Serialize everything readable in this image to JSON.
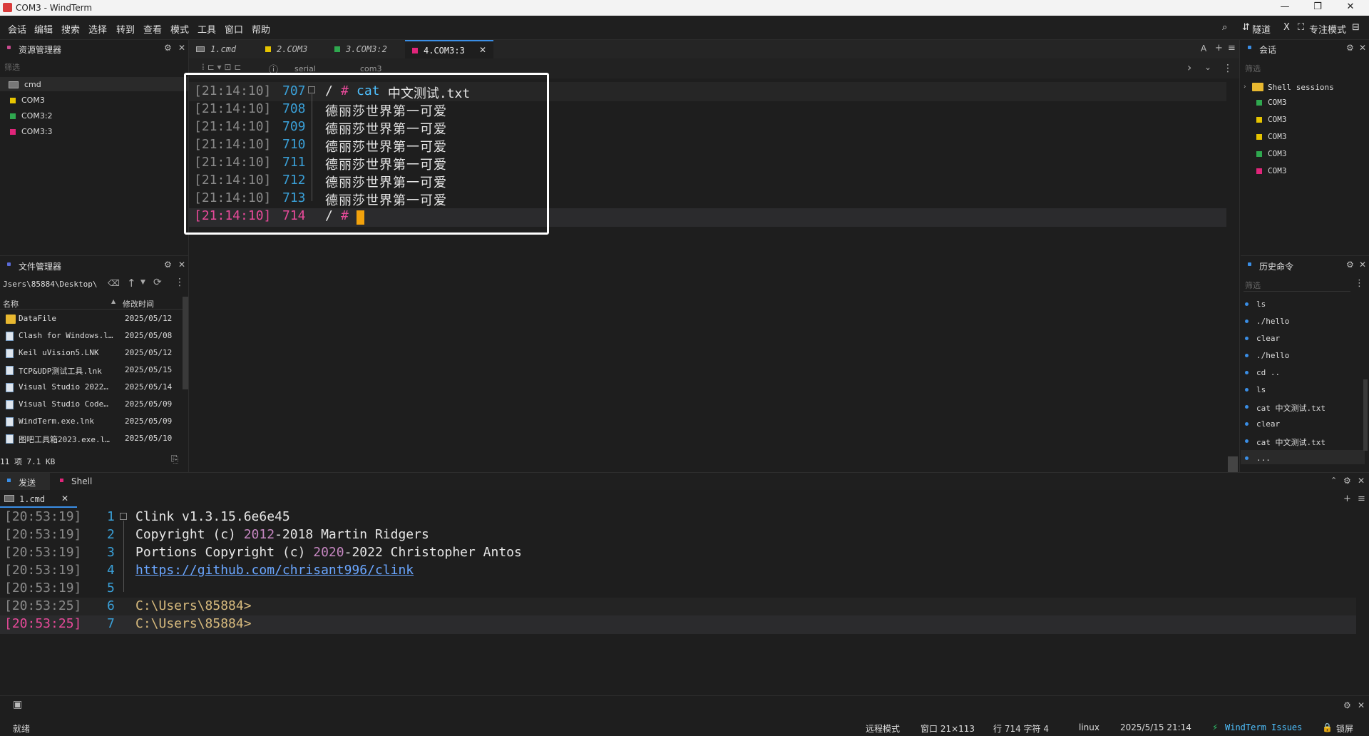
{
  "window": {
    "title": "COM3 - WindTerm",
    "minimize": "—",
    "maximize": "❐",
    "close": "✕"
  },
  "menubar": {
    "items": [
      "会话",
      "编辑",
      "搜索",
      "选择",
      "转到",
      "查看",
      "模式",
      "工具",
      "窗口",
      "帮助"
    ],
    "right": {
      "search": "⌕",
      "tunnel": "隧道",
      "x": "X",
      "focus": "专注模式",
      "layout": "⊟"
    }
  },
  "resource_manager": {
    "title": "资源管理器",
    "filter": "筛选",
    "items": [
      {
        "label": "cmd",
        "color": "#9a9a9a"
      },
      {
        "label": "COM3",
        "color": "#e6c400"
      },
      {
        "label": "COM3:2",
        "color": "#2fa84f"
      },
      {
        "label": "COM3:3",
        "color": "#e0257a"
      }
    ]
  },
  "file_manager": {
    "title": "文件管理器",
    "path": "Jsers\\85884\\Desktop\\",
    "col_name": "名称",
    "col_date": "修改时间",
    "files": [
      {
        "name": "DataFile",
        "date": "2025/05/12",
        "kind": "folder"
      },
      {
        "name": "Clash for Windows.l…",
        "date": "2025/05/08",
        "kind": "file"
      },
      {
        "name": "Keil uVision5.LNK",
        "date": "2025/05/12",
        "kind": "file"
      },
      {
        "name": "TCP&UDP测试工具.lnk",
        "date": "2025/05/15",
        "kind": "file"
      },
      {
        "name": "Visual Studio 2022…",
        "date": "2025/05/14",
        "kind": "file"
      },
      {
        "name": "Visual Studio Code…",
        "date": "2025/05/09",
        "kind": "file"
      },
      {
        "name": "WindTerm.exe.lnk",
        "date": "2025/05/09",
        "kind": "file"
      },
      {
        "name": "图吧工具箱2023.exe.l…",
        "date": "2025/05/10",
        "kind": "file"
      }
    ],
    "summary": "11 项 7.1 KB"
  },
  "tabs": [
    {
      "label": "1.cmd",
      "color": "#9a9a9a"
    },
    {
      "label": "2.COM3",
      "color": "#e6c400"
    },
    {
      "label": "3.COM3:2",
      "color": "#2fa84f"
    },
    {
      "label": "4.COM3:3",
      "color": "#e0257a"
    }
  ],
  "breadcrumb": {
    "a": "serial",
    "b": "com3"
  },
  "terminal": {
    "lines": [
      {
        "ts": "[21:14:10]",
        "ln": "707",
        "prompt": "/",
        "hash": "#",
        "cmd": "cat",
        "arg": " 中文测试.txt"
      },
      {
        "ts": "[21:14:10]",
        "ln": "708",
        "text": "德丽莎世界第一可爱"
      },
      {
        "ts": "[21:14:10]",
        "ln": "709",
        "text": "德丽莎世界第一可爱"
      },
      {
        "ts": "[21:14:10]",
        "ln": "710",
        "text": "德丽莎世界第一可爱"
      },
      {
        "ts": "[21:14:10]",
        "ln": "711",
        "text": "德丽莎世界第一可爱"
      },
      {
        "ts": "[21:14:10]",
        "ln": "712",
        "text": "德丽莎世界第一可爱"
      },
      {
        "ts": "[21:14:10]",
        "ln": "713",
        "text": "德丽莎世界第一可爱"
      },
      {
        "ts": "[21:14:10]",
        "ln": "714",
        "prompt": "/",
        "hash": "#"
      }
    ]
  },
  "sessions": {
    "title": "会话",
    "filter": "筛选",
    "group": "Shell sessions",
    "items": [
      {
        "label": "COM3",
        "color": "#2fa84f"
      },
      {
        "label": "COM3",
        "color": "#e6c400"
      },
      {
        "label": "COM3",
        "color": "#e6c400"
      },
      {
        "label": "COM3",
        "color": "#2fa84f"
      },
      {
        "label": "COM3",
        "color": "#e0257a"
      }
    ]
  },
  "history": {
    "title": "历史命令",
    "filter": "筛选",
    "items": [
      "ls",
      "./hello",
      "clear",
      "./hello",
      "cd ..",
      "ls",
      "cat 中文测试.txt",
      "clear",
      "cat 中文测试.txt",
      "..."
    ]
  },
  "bottom": {
    "tab_send": "发送",
    "tab_shell": "Shell",
    "subtab": "1.cmd",
    "lines": [
      {
        "ts": "[20:53:19]",
        "ln": "1",
        "text": "Clink v1.3.15.6e6e45"
      },
      {
        "ts": "[20:53:19]",
        "ln": "2",
        "pre": "Copyright (c) ",
        "year": "2012",
        "post": "-2018 Martin Ridgers"
      },
      {
        "ts": "[20:53:19]",
        "ln": "3",
        "pre": "Portions Copyright (c) ",
        "year": "2020",
        "post": "-2022 Christopher Antos"
      },
      {
        "ts": "[20:53:19]",
        "ln": "4",
        "link": "https://github.com/chrisant996/clink"
      },
      {
        "ts": "[20:53:19]",
        "ln": "5",
        "text": ""
      },
      {
        "ts": "[20:53:25]",
        "ln": "6",
        "prompt": "C:\\Users\\85884>"
      },
      {
        "ts": "[20:53:25]",
        "ln": "7",
        "prompt": "C:\\Users\\85884>"
      }
    ]
  },
  "status": {
    "ready": "就绪",
    "remote_mode": "远程模式",
    "window": "窗口 21×113",
    "position": "行 714 字符 4",
    "os": "linux",
    "datetime": "2025/5/15 21:14",
    "issues": "WindTerm Issues",
    "lock": "锁屏"
  },
  "colors": {
    "accent": "#3a8ee6",
    "highlight_box": "#ffffff",
    "cursor": "#f2a20c"
  }
}
